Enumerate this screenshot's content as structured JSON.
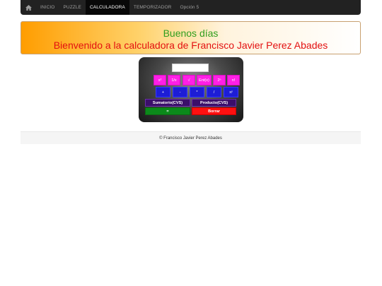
{
  "navbar": {
    "home_icon": "home-icon",
    "items": [
      {
        "label": "INICIO"
      },
      {
        "label": "PUZZLE"
      },
      {
        "label": "CALCULADORA",
        "active": true
      },
      {
        "label": "TEMPORIZADOR"
      },
      {
        "label": "Opción 5"
      }
    ]
  },
  "banner": {
    "greeting": "Buenos días",
    "welcome": "Bienvenido a la calculadora de Francisco Javier Perez Abades"
  },
  "calculator": {
    "display_value": "",
    "row1": [
      "x²",
      "1/x",
      "√",
      "Ent(x)",
      "2ⁿ",
      "n!"
    ],
    "row2": [
      "+",
      "-",
      "*",
      "/",
      "xʸ"
    ],
    "sum_label": "Sumatorio(CVS)",
    "product_label": "Producto(CVS)",
    "equals_label": "=",
    "clear_label": "Borrar"
  },
  "footer": {
    "text": "© Francisco Javier Perez Abades"
  },
  "colors": {
    "navbar": "#222222",
    "greeting": "#2e9e1e",
    "welcome": "#e31010",
    "function_button": "#ff1fe6",
    "operator_button": "#1d1dd6",
    "csv_button": "#3b0f6a",
    "equals_button": "#0b8a1a",
    "clear_button": "#ff1010"
  }
}
